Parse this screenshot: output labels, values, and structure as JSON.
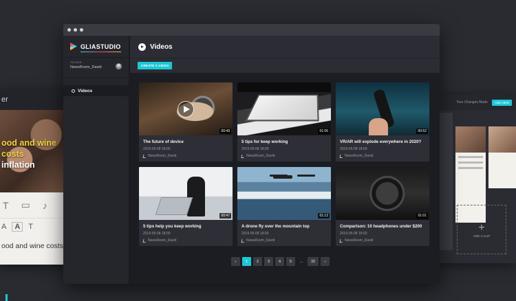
{
  "background_left": {
    "title_fragment": "er",
    "headline_line1a": "ood and wine costs",
    "headline_line2a": "inflation",
    "body_text": "ood and wine costs push"
  },
  "background_right": {
    "bar_text": "Your Changes Made",
    "button_label": "ADD NEW",
    "add_clip": "ADD A CLIP"
  },
  "app": {
    "logo": "GLIASTUDIO",
    "account_label": "Account",
    "account_name": "NewsRoom_David",
    "nav": [
      {
        "label": "Videos",
        "icon": "eye-icon"
      }
    ],
    "page_title": "Videos",
    "create_button": "CREATE A VIDEO"
  },
  "videos": [
    {
      "title": "The future of device",
      "date": "2019-05-08 18:00",
      "author": "NewsRoom_David",
      "duration": "00:49",
      "featured": true
    },
    {
      "title": "5 tips for keep working",
      "date": "2019-05-08 18:00",
      "author": "NewsRoom_David",
      "duration": "01:06"
    },
    {
      "title": "VR/AR will explode everywhere in 2020?",
      "date": "2019-05-08 18:00",
      "author": "NewsRoom_David",
      "duration": "00:52"
    },
    {
      "title": "5 tips help you keep working",
      "date": "2019-05-08 18:00",
      "author": "NewsRoom_David",
      "duration": "00:47"
    },
    {
      "title": "A drone fly over the mountain top",
      "date": "2019-05-08 18:00",
      "author": "NewsRoom_David",
      "duration": "01:12"
    },
    {
      "title": "Comparison: 10 headphones under $200",
      "date": "2019-05-08 18:00",
      "author": "NewsRoom_David",
      "duration": "01:01"
    }
  ],
  "pagination": {
    "prev": "‹",
    "pages": [
      "1",
      "2",
      "3",
      "4",
      "5"
    ],
    "ellipsis": "...",
    "last": "32",
    "next": "›",
    "current": "1"
  },
  "colors": {
    "accent": "#1ec8d6",
    "background": "#2a2b31",
    "panel": "#2c2d34"
  }
}
